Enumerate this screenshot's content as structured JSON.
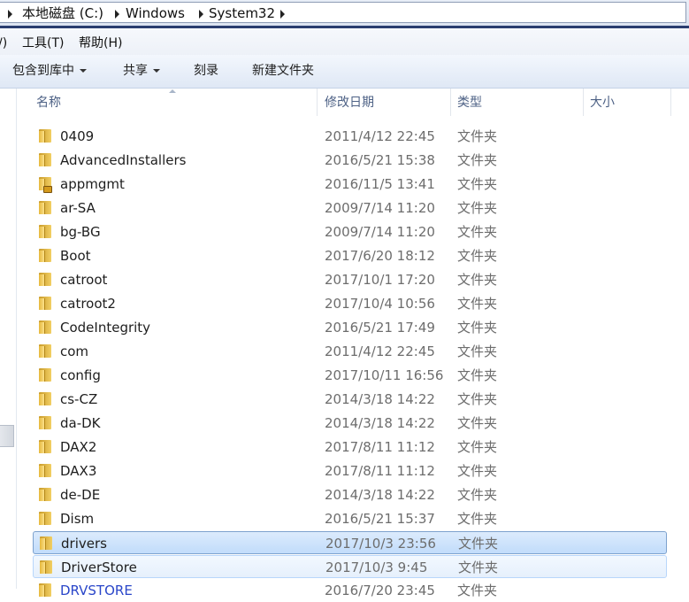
{
  "address": {
    "crumbs": [
      "本地磁盘 (C:)",
      "Windows",
      "System32"
    ]
  },
  "menu": {
    "items": [
      "/)",
      "工具(T)",
      "帮助(H)"
    ]
  },
  "toolbar": {
    "include_library": "包含到库中",
    "share": "共享",
    "burn": "刻录",
    "new_folder": "新建文件夹"
  },
  "columns": {
    "name": "名称",
    "date": "修改日期",
    "type": "类型",
    "size": "大小"
  },
  "rows": [
    {
      "name": "0409",
      "date": "2011/4/12 22:45",
      "type": "文件夹"
    },
    {
      "name": "AdvancedInstallers",
      "date": "2016/5/21 15:38",
      "type": "文件夹"
    },
    {
      "name": "appmgmt",
      "date": "2016/11/5 13:41",
      "type": "文件夹",
      "locked": true
    },
    {
      "name": "ar-SA",
      "date": "2009/7/14 11:20",
      "type": "文件夹"
    },
    {
      "name": "bg-BG",
      "date": "2009/7/14 11:20",
      "type": "文件夹"
    },
    {
      "name": "Boot",
      "date": "2017/6/20 18:12",
      "type": "文件夹"
    },
    {
      "name": "catroot",
      "date": "2017/10/1 17:20",
      "type": "文件夹"
    },
    {
      "name": "catroot2",
      "date": "2017/10/4 10:56",
      "type": "文件夹"
    },
    {
      "name": "CodeIntegrity",
      "date": "2016/5/21 17:49",
      "type": "文件夹"
    },
    {
      "name": "com",
      "date": "2011/4/12 22:45",
      "type": "文件夹"
    },
    {
      "name": "config",
      "date": "2017/10/11 16:56",
      "type": "文件夹"
    },
    {
      "name": "cs-CZ",
      "date": "2014/3/18 14:22",
      "type": "文件夹"
    },
    {
      "name": "da-DK",
      "date": "2014/3/18 14:22",
      "type": "文件夹"
    },
    {
      "name": "DAX2",
      "date": "2017/8/11 11:12",
      "type": "文件夹"
    },
    {
      "name": "DAX3",
      "date": "2017/8/11 11:12",
      "type": "文件夹"
    },
    {
      "name": "de-DE",
      "date": "2014/3/18 14:22",
      "type": "文件夹"
    },
    {
      "name": "Dism",
      "date": "2016/5/21 15:37",
      "type": "文件夹"
    },
    {
      "name": "drivers",
      "date": "2017/10/3 23:56",
      "type": "文件夹",
      "state": "selected"
    },
    {
      "name": "DriverStore",
      "date": "2017/10/3 9:45",
      "type": "文件夹",
      "state": "hover"
    },
    {
      "name": "DRVSTORE",
      "date": "2016/7/20 23:45",
      "type": "文件夹",
      "link": true
    }
  ]
}
